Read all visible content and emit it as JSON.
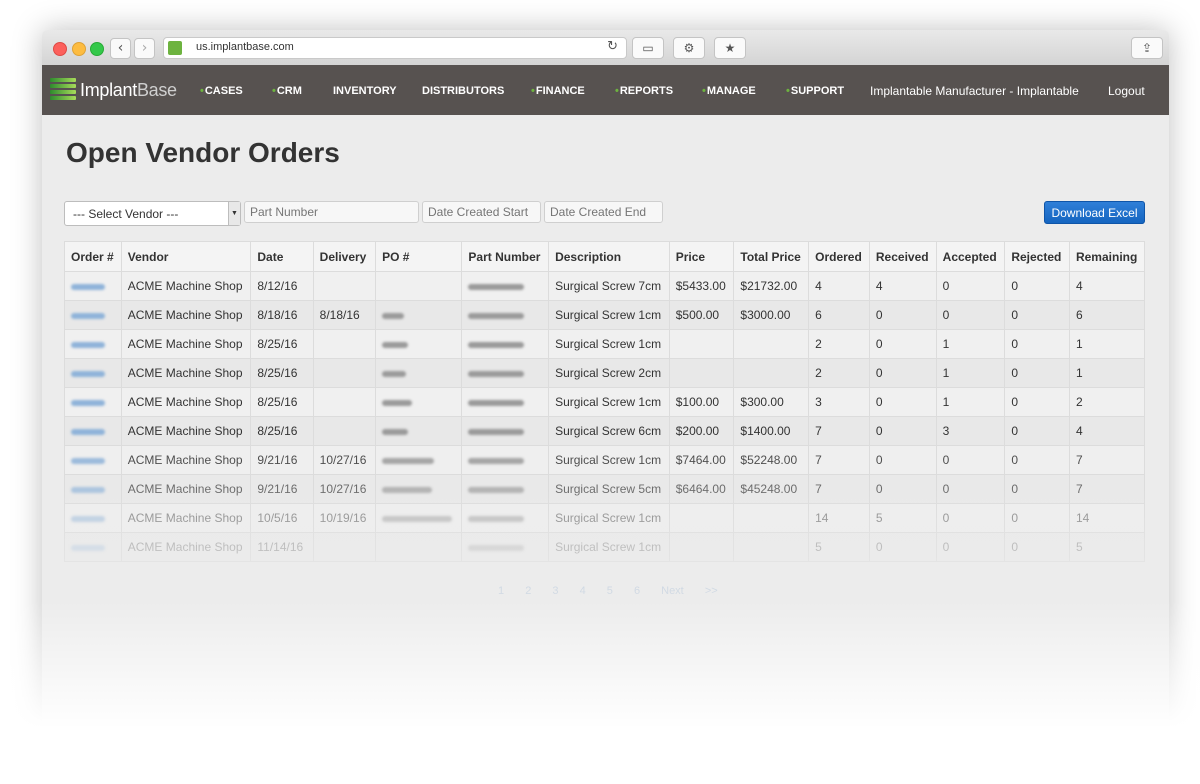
{
  "browser": {
    "url": "us.implantbase.com",
    "back_glyph": "‹",
    "forward_glyph": "›",
    "reload_glyph": "↻",
    "sidebar_glyph": "▭",
    "settings_glyph": "⚙",
    "bookmark_glyph": "★",
    "share_glyph": "⇪"
  },
  "navbar": {
    "logo_primary": "Implant",
    "logo_secondary": "Base",
    "items": [
      "CASES",
      "CRM",
      "INVENTORY",
      "DISTRIBUTORS",
      "FINANCE",
      "REPORTS",
      "MANAGE",
      "SUPPORT"
    ],
    "dot": "•",
    "user": "Implantable Manufacturer - Implantable",
    "logout": "Logout",
    "accent_color": "#6db33f"
  },
  "page": {
    "title": "Open Vendor Orders"
  },
  "filters": {
    "vendor_select": "--- Select Vendor ---",
    "part_number_placeholder": "Part Number",
    "date_start_placeholder": "Date Created Start",
    "date_end_placeholder": "Date Created End",
    "download_label": "Download Excel"
  },
  "table": {
    "columns": [
      "Order #",
      "Vendor",
      "Date",
      "Delivery",
      "PO #",
      "Part Number",
      "Description",
      "Price",
      "Total Price",
      "Ordered",
      "Received",
      "Accepted",
      "Rejected",
      "Remaining"
    ],
    "rows": [
      {
        "vendor": "ACME Machine Shop",
        "date": "8/12/16",
        "delivery": "",
        "po": false,
        "description": "Surgical Screw 7cm",
        "price": "$5433.00",
        "total": "$21732.00",
        "ordered": "4",
        "received": "4",
        "accepted": "0",
        "rejected": "0",
        "remaining": "4"
      },
      {
        "vendor": "ACME Machine Shop",
        "date": "8/18/16",
        "delivery": "8/18/16",
        "po": true,
        "description": "Surgical Screw 1cm",
        "price": "$500.00",
        "total": "$3000.00",
        "ordered": "6",
        "received": "0",
        "accepted": "0",
        "rejected": "0",
        "remaining": "6"
      },
      {
        "vendor": "ACME Machine Shop",
        "date": "8/25/16",
        "delivery": "",
        "po": true,
        "description": "Surgical Screw 1cm",
        "price": "",
        "total": "",
        "ordered": "2",
        "received": "0",
        "accepted": "1",
        "rejected": "0",
        "remaining": "1"
      },
      {
        "vendor": "ACME Machine Shop",
        "date": "8/25/16",
        "delivery": "",
        "po": true,
        "description": "Surgical Screw 2cm",
        "price": "",
        "total": "",
        "ordered": "2",
        "received": "0",
        "accepted": "1",
        "rejected": "0",
        "remaining": "1"
      },
      {
        "vendor": "ACME Machine Shop",
        "date": "8/25/16",
        "delivery": "",
        "po": true,
        "description": "Surgical Screw 1cm",
        "price": "$100.00",
        "total": "$300.00",
        "ordered": "3",
        "received": "0",
        "accepted": "1",
        "rejected": "0",
        "remaining": "2"
      },
      {
        "vendor": "ACME Machine Shop",
        "date": "8/25/16",
        "delivery": "",
        "po": true,
        "description": "Surgical Screw 6cm",
        "price": "$200.00",
        "total": "$1400.00",
        "ordered": "7",
        "received": "0",
        "accepted": "3",
        "rejected": "0",
        "remaining": "4"
      },
      {
        "vendor": "ACME Machine Shop",
        "date": "9/21/16",
        "delivery": "10/27/16",
        "po": true,
        "description": "Surgical Screw 1cm",
        "price": "$7464.00",
        "total": "$52248.00",
        "ordered": "7",
        "received": "0",
        "accepted": "0",
        "rejected": "0",
        "remaining": "7"
      },
      {
        "vendor": "ACME Machine Shop",
        "date": "9/21/16",
        "delivery": "10/27/16",
        "po": true,
        "description": "Surgical Screw 5cm",
        "price": "$6464.00",
        "total": "$45248.00",
        "ordered": "7",
        "received": "0",
        "accepted": "0",
        "rejected": "0",
        "remaining": "7"
      },
      {
        "vendor": "ACME Machine Shop",
        "date": "10/5/16",
        "delivery": "10/19/16",
        "po": true,
        "description": "Surgical Screw 1cm",
        "price": "",
        "total": "",
        "ordered": "14",
        "received": "5",
        "accepted": "0",
        "rejected": "0",
        "remaining": "14"
      },
      {
        "vendor": "ACME Machine Shop",
        "date": "11/14/16",
        "delivery": "",
        "po": false,
        "description": "Surgical Screw 1cm",
        "price": "",
        "total": "",
        "ordered": "5",
        "received": "0",
        "accepted": "0",
        "rejected": "0",
        "remaining": "5"
      }
    ]
  },
  "pagination": {
    "pages": [
      "1",
      "2",
      "3",
      "4",
      "5",
      "6"
    ],
    "next": "Next",
    "last": ">>"
  }
}
